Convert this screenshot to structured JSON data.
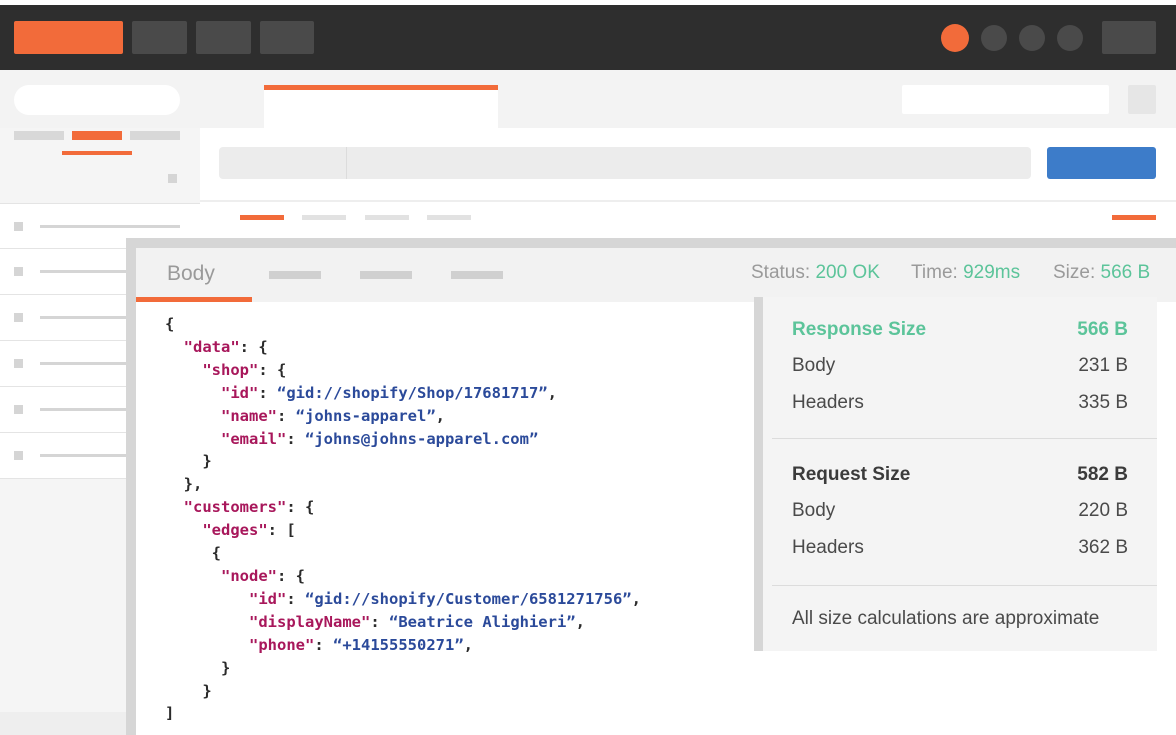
{
  "colors": {
    "accent": "#f26b3a",
    "send": "#3d7cc9",
    "success": "#5cc49a",
    "key": "#a8175b",
    "string": "#2b4a9a"
  },
  "response": {
    "tab_label": "Body",
    "status_label": "Status:",
    "status_value": "200 OK",
    "time_label": "Time:",
    "time_value": "929ms",
    "size_label": "Size:",
    "size_value": "566 B"
  },
  "code_lines": [
    [
      [
        "p",
        "{"
      ]
    ],
    [
      [
        "p",
        "  "
      ],
      [
        "k",
        "\"data\""
      ],
      [
        "p",
        ": {"
      ]
    ],
    [
      [
        "p",
        "    "
      ],
      [
        "k",
        "\"shop\""
      ],
      [
        "p",
        ": {"
      ]
    ],
    [
      [
        "p",
        "      "
      ],
      [
        "k",
        "\"id\""
      ],
      [
        "p",
        ": "
      ],
      [
        "s",
        "“gid://shopify/Shop/17681717”"
      ],
      [
        "p",
        ","
      ]
    ],
    [
      [
        "p",
        "      "
      ],
      [
        "k",
        "\"name\""
      ],
      [
        "p",
        ": "
      ],
      [
        "s",
        "“johns-apparel”"
      ],
      [
        "p",
        ","
      ]
    ],
    [
      [
        "p",
        "      "
      ],
      [
        "k",
        "\"email\""
      ],
      [
        "p",
        ": "
      ],
      [
        "s",
        "“johns@johns-apparel.com”"
      ]
    ],
    [
      [
        "p",
        "    }"
      ]
    ],
    [
      [
        "p",
        "  },"
      ]
    ],
    [
      [
        "p",
        "  "
      ],
      [
        "k",
        "\"customers\""
      ],
      [
        "p",
        ": {"
      ]
    ],
    [
      [
        "p",
        "    "
      ],
      [
        "k",
        "\"edges\""
      ],
      [
        "p",
        ": ["
      ]
    ],
    [
      [
        "p",
        "     {"
      ]
    ],
    [
      [
        "p",
        "      "
      ],
      [
        "k",
        "\"node\""
      ],
      [
        "p",
        ": {"
      ]
    ],
    [
      [
        "p",
        "         "
      ],
      [
        "k",
        "\"id\""
      ],
      [
        "p",
        ": "
      ],
      [
        "s",
        "“gid://shopify/Customer/6581271756”"
      ],
      [
        "p",
        ","
      ]
    ],
    [
      [
        "p",
        "         "
      ],
      [
        "k",
        "\"displayName\""
      ],
      [
        "p",
        ": "
      ],
      [
        "s",
        "“Beatrice Alighieri”"
      ],
      [
        "p",
        ","
      ]
    ],
    [
      [
        "p",
        "         "
      ],
      [
        "k",
        "\"phone\""
      ],
      [
        "p",
        ": "
      ],
      [
        "s",
        "“+14155550271”"
      ],
      [
        "p",
        ","
      ]
    ],
    [
      [
        "p",
        "      }"
      ]
    ],
    [
      [
        "p",
        "    }"
      ]
    ],
    [
      [
        "p",
        "]"
      ]
    ]
  ],
  "size_popover": {
    "response_title": "Response Size",
    "response_total": "566 B",
    "response_body_label": "Body",
    "response_body_value": "231 B",
    "response_headers_label": "Headers",
    "response_headers_value": "335 B",
    "request_title": "Request Size",
    "request_total": "582 B",
    "request_body_label": "Body",
    "request_body_value": "220 B",
    "request_headers_label": "Headers",
    "request_headers_value": "362 B",
    "note": "All size calculations are approximate"
  }
}
